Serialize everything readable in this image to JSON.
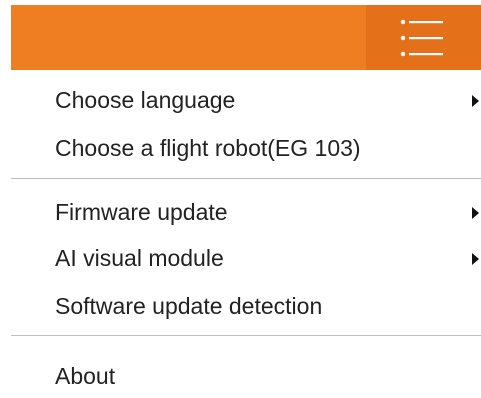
{
  "header": {
    "background_color": "#ef7d22",
    "menu_button_color": "#e5701a",
    "menu_icon": "hamburger-list-icon"
  },
  "menu": {
    "items": [
      {
        "label": "Choose language",
        "has_submenu": true
      },
      {
        "label": "Choose a flight robot(EG 103)",
        "has_submenu": false
      },
      {
        "label": "Firmware update",
        "has_submenu": true
      },
      {
        "label": "AI visual module",
        "has_submenu": true
      },
      {
        "label": "Software update detection",
        "has_submenu": false
      },
      {
        "label": "About",
        "has_submenu": false
      }
    ],
    "submenu_arrow_icon": "caret-right-icon"
  }
}
